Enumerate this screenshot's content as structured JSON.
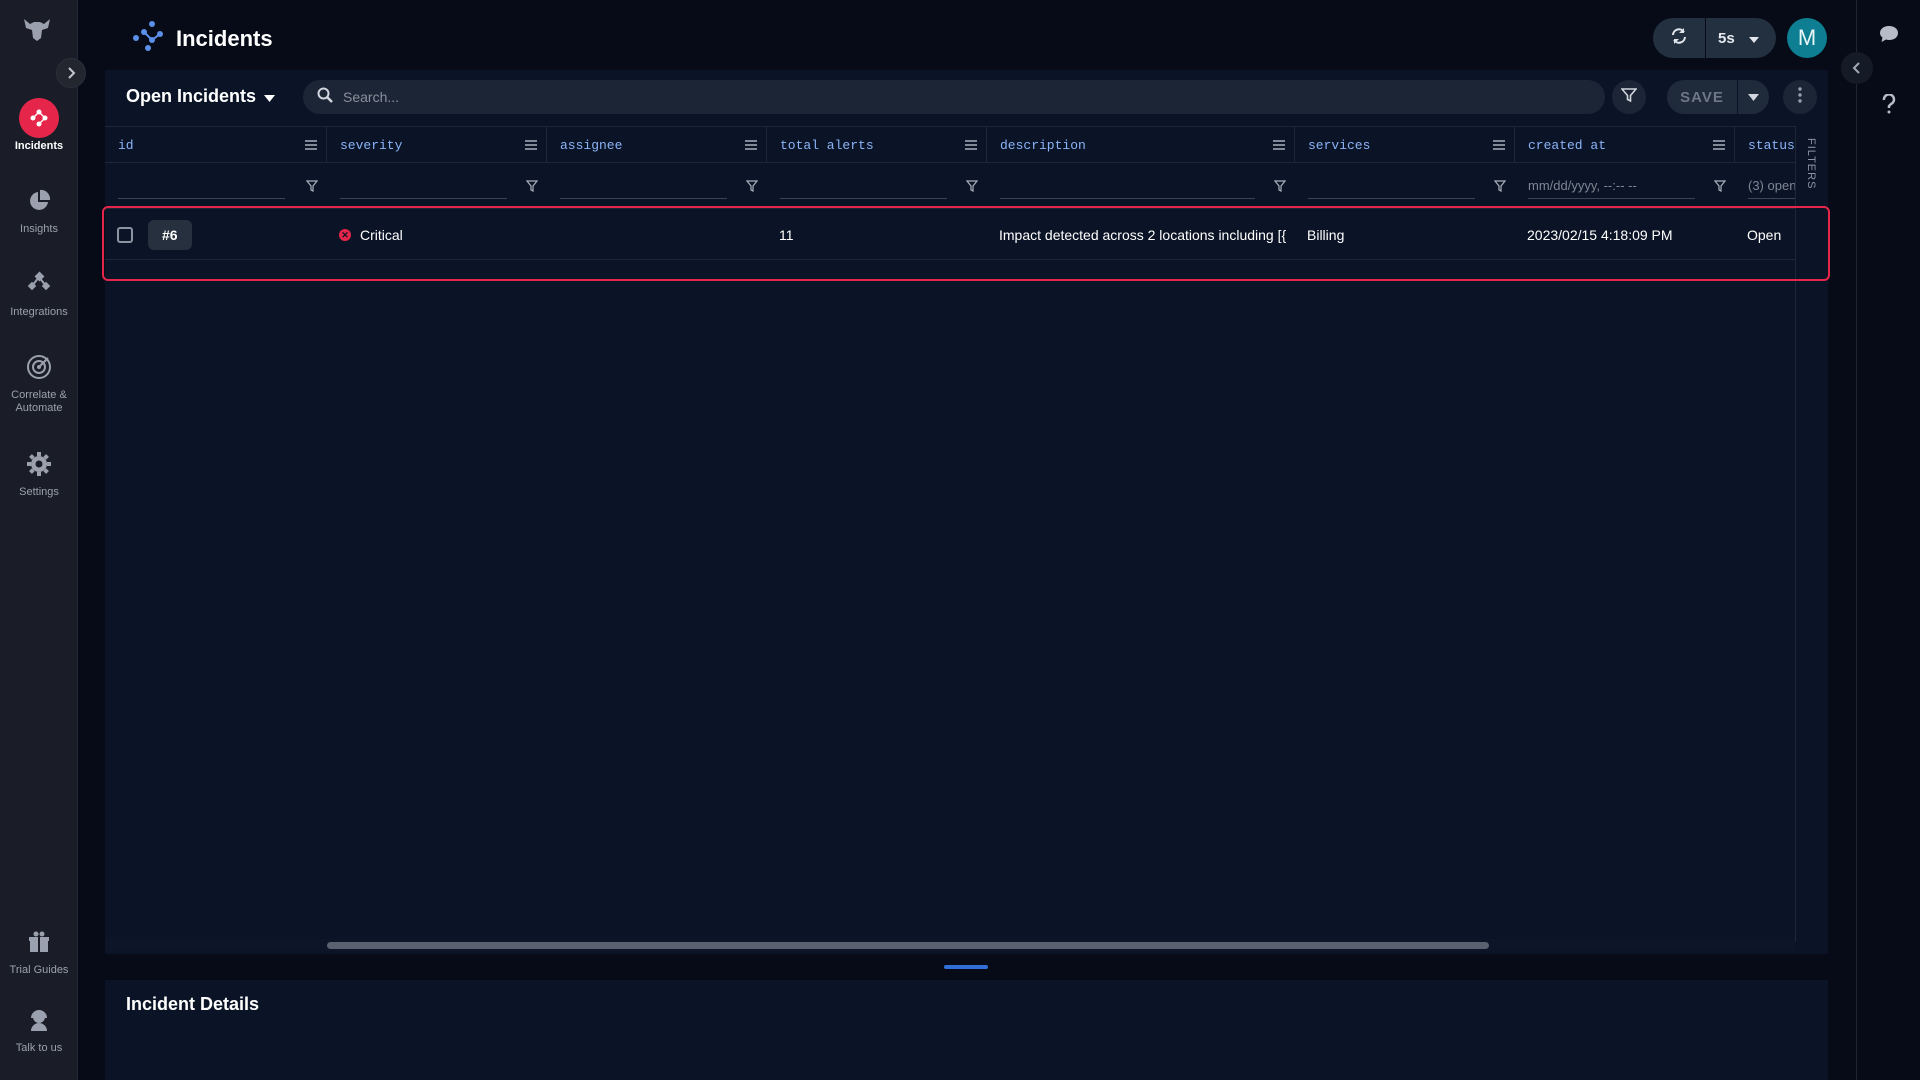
{
  "app": {
    "page_title": "Incidents",
    "refresh_interval": "5s",
    "user_initial": "M"
  },
  "sidebar": {
    "items": [
      {
        "key": "incidents",
        "label": "Incidents",
        "icon": "incidents-icon",
        "active": true
      },
      {
        "key": "insights",
        "label": "Insights",
        "icon": "pie-chart-icon",
        "active": false
      },
      {
        "key": "integrations",
        "label": "Integrations",
        "icon": "integrations-icon",
        "active": false
      },
      {
        "key": "correlate",
        "label": "Correlate & Automate",
        "icon": "target-icon",
        "active": false
      },
      {
        "key": "settings",
        "label": "Settings",
        "icon": "gear-icon",
        "active": false
      }
    ],
    "bottom": [
      {
        "key": "trial-guides",
        "label": "Trial Guides",
        "icon": "gift-icon"
      },
      {
        "key": "talk",
        "label": "Talk to us",
        "icon": "support-icon"
      }
    ]
  },
  "toolbar": {
    "view_label": "Open Incidents",
    "search_placeholder": "Search...",
    "save_label": "SAVE"
  },
  "grid": {
    "columns": [
      {
        "key": "id",
        "label": "id",
        "filter": ""
      },
      {
        "key": "severity",
        "label": "severity",
        "filter": ""
      },
      {
        "key": "assignee",
        "label": "assignee",
        "filter": ""
      },
      {
        "key": "total_alerts",
        "label": "total alerts",
        "filter": ""
      },
      {
        "key": "description",
        "label": "description",
        "filter": ""
      },
      {
        "key": "services",
        "label": "services",
        "filter": ""
      },
      {
        "key": "created_at",
        "label": "created at",
        "filter": "mm/dd/yyyy, --:-- --"
      },
      {
        "key": "status",
        "label": "status",
        "filter": "(3) open"
      }
    ],
    "rows": [
      {
        "id": "#6",
        "severity": "Critical",
        "assignee": "",
        "total_alerts": "11",
        "description": "Impact detected across 2 locations including [{",
        "services": "Billing",
        "created_at": "2023/02/15 4:18:09 PM",
        "status": "Open"
      }
    ],
    "side_panel_label": "FILTERS"
  },
  "details": {
    "title": "Incident Details"
  },
  "colors": {
    "accent_red": "#e5264a",
    "header_text": "#8ab4f8",
    "avatar": "#0e7f92",
    "background": "#060b17",
    "panel": "#0b1426"
  }
}
